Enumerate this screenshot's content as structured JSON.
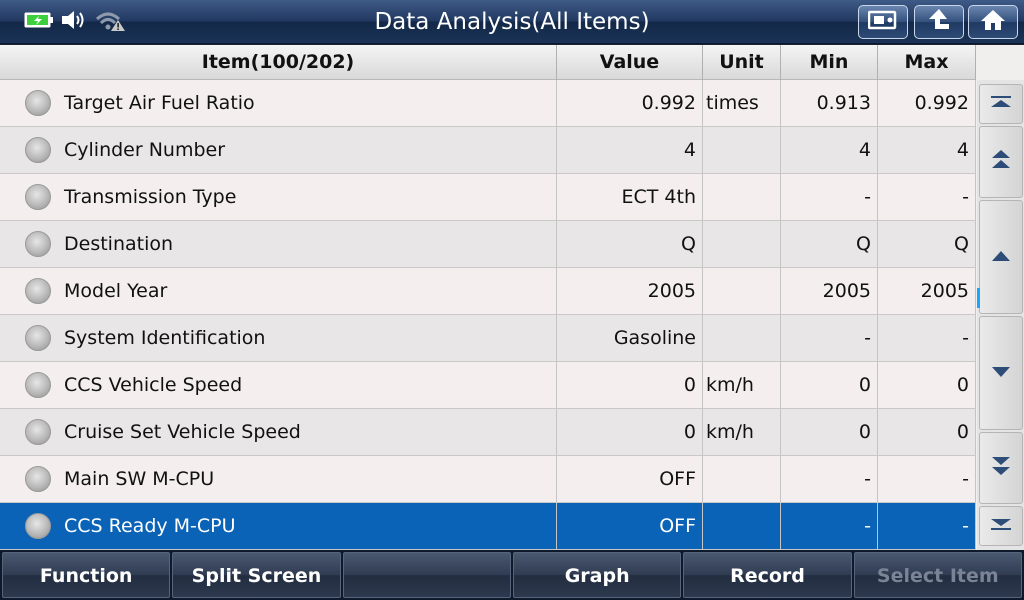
{
  "header": {
    "title": "Data Analysis(All Items)",
    "status_icons": [
      "battery-charging-icon",
      "speaker-icon",
      "wifi-warning-icon"
    ],
    "buttons": [
      "screenshot-icon",
      "back-icon",
      "home-icon"
    ]
  },
  "table": {
    "columns": {
      "item": "Item(100/202)",
      "value": "Value",
      "unit": "Unit",
      "min": "Min",
      "max": "Max"
    },
    "rows": [
      {
        "item": "Target Air Fuel Ratio",
        "value": "0.992",
        "unit": "times",
        "min": "0.913",
        "max": "0.992"
      },
      {
        "item": "Cylinder Number",
        "value": "4",
        "unit": "",
        "min": "4",
        "max": "4"
      },
      {
        "item": "Transmission Type",
        "value": "ECT 4th",
        "unit": "",
        "min": "-",
        "max": "-"
      },
      {
        "item": "Destination",
        "value": "Q",
        "unit": "",
        "min": "Q",
        "max": "Q"
      },
      {
        "item": "Model Year",
        "value": "2005",
        "unit": "",
        "min": "2005",
        "max": "2005"
      },
      {
        "item": "System Identification",
        "value": "Gasoline",
        "unit": "",
        "min": "-",
        "max": "-"
      },
      {
        "item": "CCS Vehicle Speed",
        "value": "0",
        "unit": "km/h",
        "min": "0",
        "max": "0"
      },
      {
        "item": "Cruise Set Vehicle Speed",
        "value": "0",
        "unit": "km/h",
        "min": "0",
        "max": "0"
      },
      {
        "item": "Main SW M-CPU",
        "value": "OFF",
        "unit": "",
        "min": "-",
        "max": "-"
      },
      {
        "item": "CCS Ready M-CPU",
        "value": "OFF",
        "unit": "",
        "min": "-",
        "max": "-",
        "selected": true
      }
    ]
  },
  "scrollbar": {
    "buttons": [
      "scroll-top-icon",
      "page-up-icon",
      "line-up-icon",
      "line-down-icon",
      "page-down-icon",
      "scroll-bottom-icon"
    ]
  },
  "footer": {
    "buttons": [
      {
        "label": "Function",
        "enabled": true
      },
      {
        "label": "Split Screen",
        "enabled": true
      },
      {
        "label": "",
        "enabled": true
      },
      {
        "label": "Graph",
        "enabled": true
      },
      {
        "label": "Record",
        "enabled": true
      },
      {
        "label": "Select Item",
        "enabled": false
      }
    ]
  },
  "colors": {
    "selected_row": "#0a63b6",
    "header_bar": "#1a3356",
    "battery": "#3ecf3e"
  }
}
